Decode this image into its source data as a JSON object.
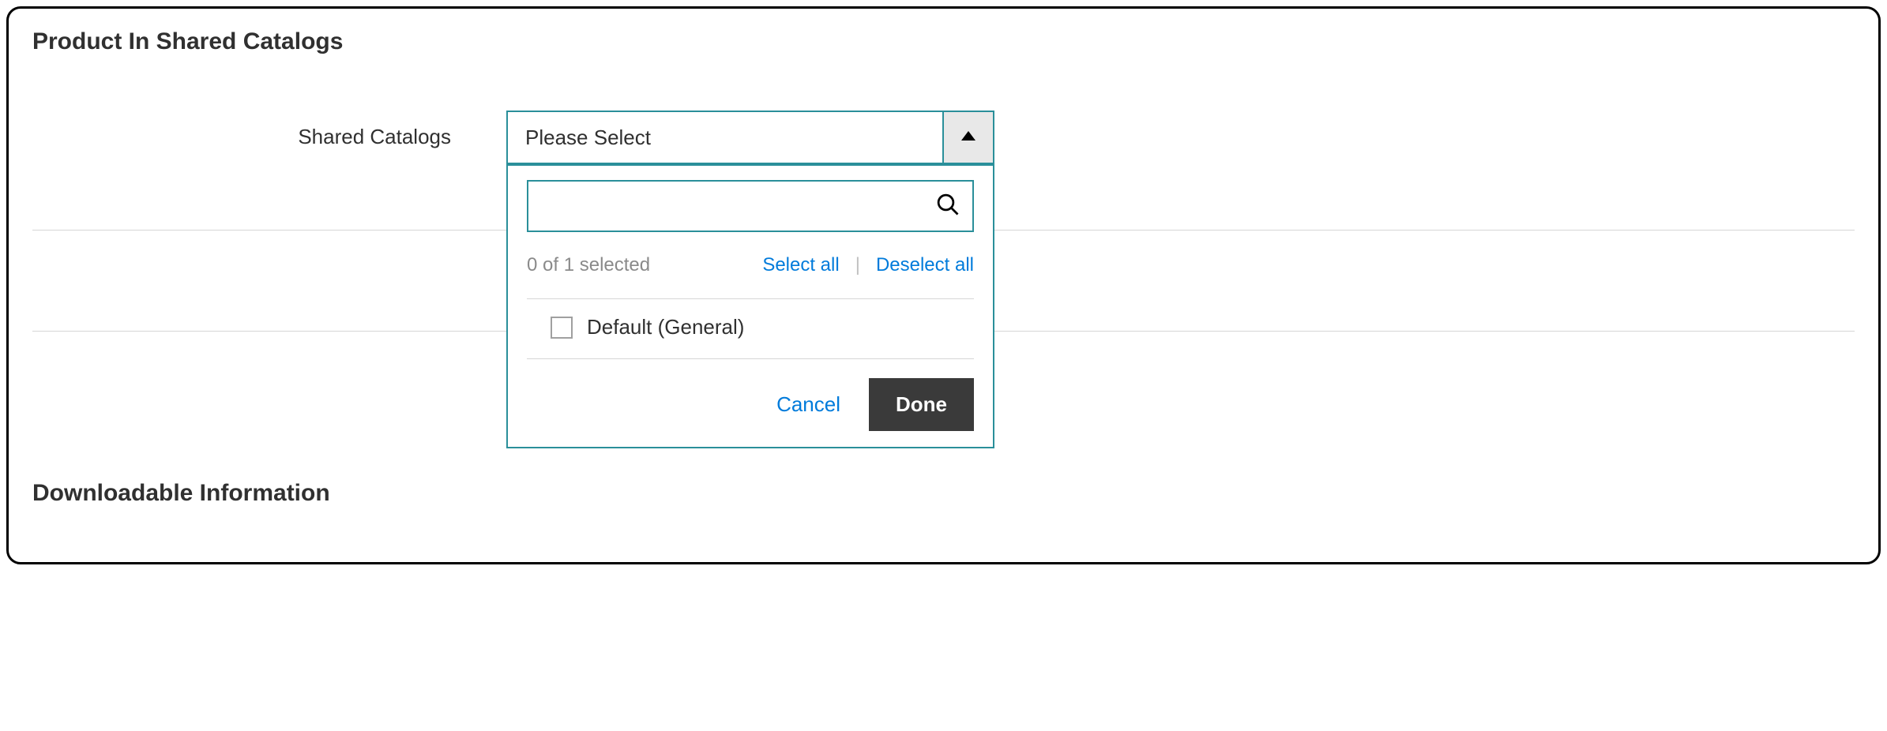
{
  "sections": {
    "shared_catalogs_title": "Product In Shared Catalogs",
    "downloadable_title": "Downloadable Information"
  },
  "form": {
    "shared_catalogs_label": "Shared Catalogs"
  },
  "multiselect": {
    "placeholder": "Please Select",
    "search_value": "",
    "selection_count": "0 of 1 selected",
    "select_all": "Select all",
    "deselect_all": "Deselect all",
    "options": [
      {
        "label": "Default (General)",
        "checked": false
      }
    ],
    "cancel": "Cancel",
    "done": "Done"
  }
}
